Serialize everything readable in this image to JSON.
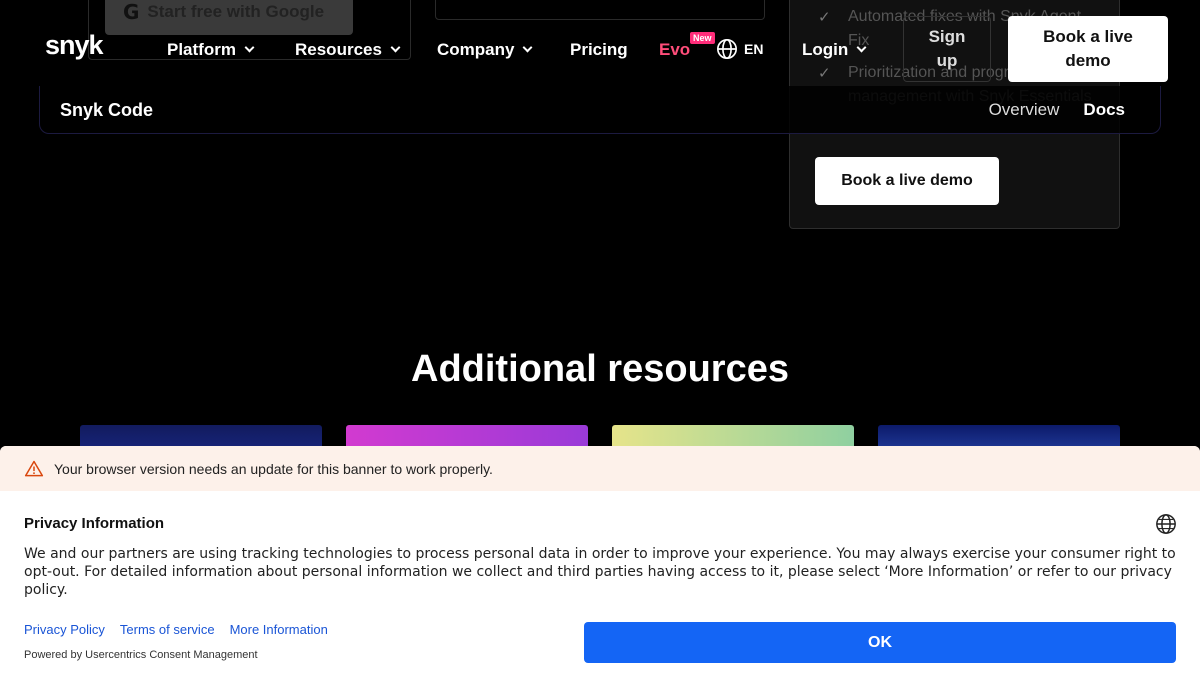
{
  "background": {
    "google_button": {
      "icon": "google-icon",
      "icon_glyph": "G",
      "label": "Start free with Google"
    },
    "pricing_panel": {
      "features": [
        "Automated fixes with Snyk Agent Fix",
        "Prioritization and progress management with Snyk Essentials"
      ],
      "demo_button": "Book a live demo"
    },
    "section_title": "Additional resources"
  },
  "header": {
    "logo": "snyk",
    "nav": [
      {
        "label": "Platform"
      },
      {
        "label": "Resources"
      },
      {
        "label": "Company"
      },
      {
        "label": "Pricing"
      }
    ],
    "evo": {
      "label": "Evo",
      "badge": "New"
    },
    "language": "EN",
    "login": "Login",
    "signup": "Sign up",
    "demo": "Book a live demo"
  },
  "subnav": {
    "title": "Snyk Code",
    "links": [
      "Overview",
      "Docs"
    ]
  },
  "consent": {
    "warning": "Your browser version needs an update for this banner to work properly.",
    "title": "Privacy Information",
    "text": "We and our partners are using tracking technologies to process personal data in order to improve your experience. You may always exercise your consumer right to opt-out. For detailed information about personal information we collect and third parties having access to it, please select ‘More Information’ or refer to our privacy policy.",
    "links": [
      "Privacy Policy",
      "Terms of service",
      "More Information"
    ],
    "powered_by": "Powered by Usercentrics Consent Management",
    "ok_label": "OK"
  },
  "colors": {
    "accent_blue": "#1465f5",
    "evo_pink": "#ff4d7a",
    "warning_bg": "#fdf1ea"
  }
}
